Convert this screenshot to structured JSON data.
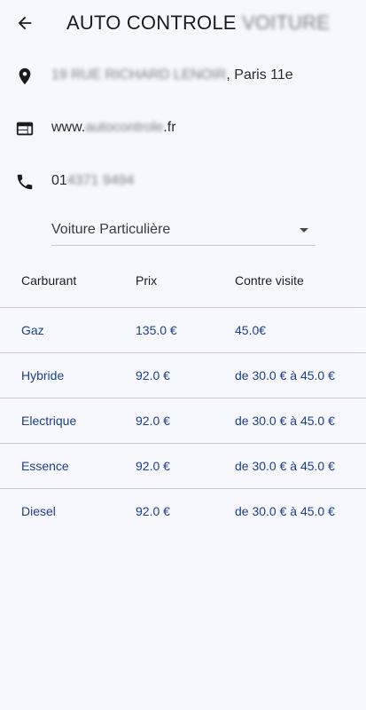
{
  "header": {
    "title_visible": "AUTO CONTROLE",
    "title_blurred": "VOITURE"
  },
  "info": {
    "address_blurred": "19 RUE RICHARD LENOIR",
    "address_visible": ", Paris 11e",
    "website_prefix": "www.",
    "website_blurred": "autocontrole",
    "website_suffix": ".fr",
    "phone_visible": "01",
    "phone_blurred": "4371 9494"
  },
  "vehicle_select": {
    "value": "Voiture Particulière"
  },
  "table": {
    "headers": [
      "Carburant",
      "Prix",
      "Contre visite"
    ],
    "rows": [
      [
        "Gaz",
        "135.0 €",
        "45.0€"
      ],
      [
        "Hybride",
        "92.0 €",
        "de 30.0 € à 45.0 €"
      ],
      [
        "Electrique",
        "92.0 €",
        "de 30.0 € à 45.0 €"
      ],
      [
        "Essence",
        "92.0 €",
        "de 30.0 € à 45.0 €"
      ],
      [
        "Diesel",
        "92.0 €",
        "de 30.0 € à 45.0 €"
      ]
    ]
  },
  "icons": {
    "back": "arrow-back-icon",
    "address": "location-pin-icon",
    "website": "web-icon",
    "phone": "phone-icon",
    "dropdown": "caret-down-icon"
  },
  "colors": {
    "background": "#f7f8fd",
    "table_text": "#1a3f8f",
    "divider": "#c9cad2"
  }
}
